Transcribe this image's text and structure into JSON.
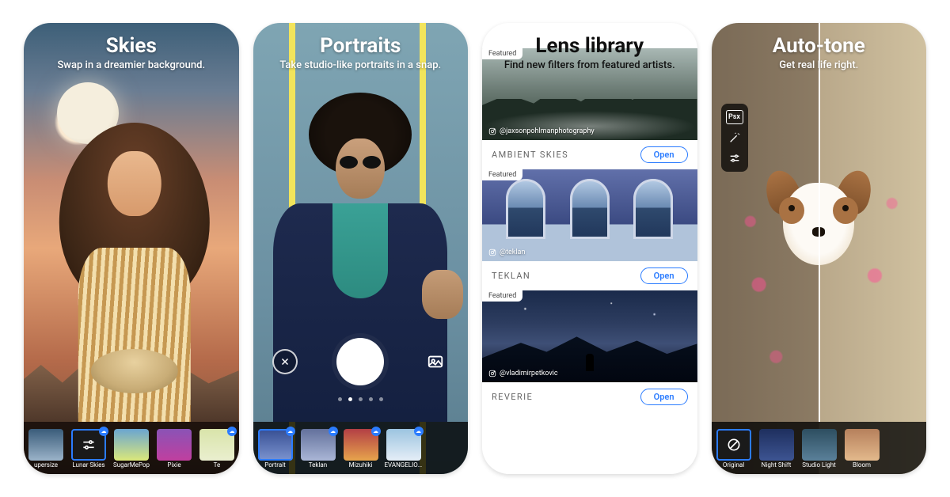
{
  "screens": {
    "skies": {
      "title": "Skies",
      "subtitle": "Swap in a dreamier background.",
      "filters": [
        {
          "label": "upersize",
          "badge": false
        },
        {
          "label": "Lunar Skies",
          "badge": true,
          "selected": true
        },
        {
          "label": "SugarMePop",
          "badge": false
        },
        {
          "label": "Pixie",
          "badge": false
        },
        {
          "label": "Te",
          "badge": true
        }
      ]
    },
    "portraits": {
      "title": "Portraits",
      "subtitle": "Take studio-like portraits in a snap.",
      "dots_active_index": 1,
      "dots_total": 5,
      "filters": [
        {
          "label": "Portrait",
          "badge": true,
          "selected": true
        },
        {
          "label": "Teklan",
          "badge": true
        },
        {
          "label": "Mizuhiki",
          "badge": true
        },
        {
          "label": "EVANGELION.",
          "badge": true
        }
      ]
    },
    "library": {
      "title": "Lens library",
      "subtitle": "Find new filters from featured artists.",
      "open_label": "Open",
      "featured_label": "Featured",
      "packs": [
        {
          "credit": "@jaxsonpohlmanphotography",
          "name": "AMBIENT SKIES"
        },
        {
          "credit": "@teklan",
          "name": "TEKLAN"
        },
        {
          "credit": "@vladimirpetkovic",
          "name": "REVERIE"
        }
      ]
    },
    "autotone": {
      "title": "Auto-tone",
      "subtitle": "Get real life right.",
      "tool_psx": "Psx",
      "filters": [
        {
          "label": "Original",
          "selected": true
        },
        {
          "label": "Night Shift"
        },
        {
          "label": "Studio Light"
        },
        {
          "label": "Bloom"
        }
      ]
    }
  }
}
